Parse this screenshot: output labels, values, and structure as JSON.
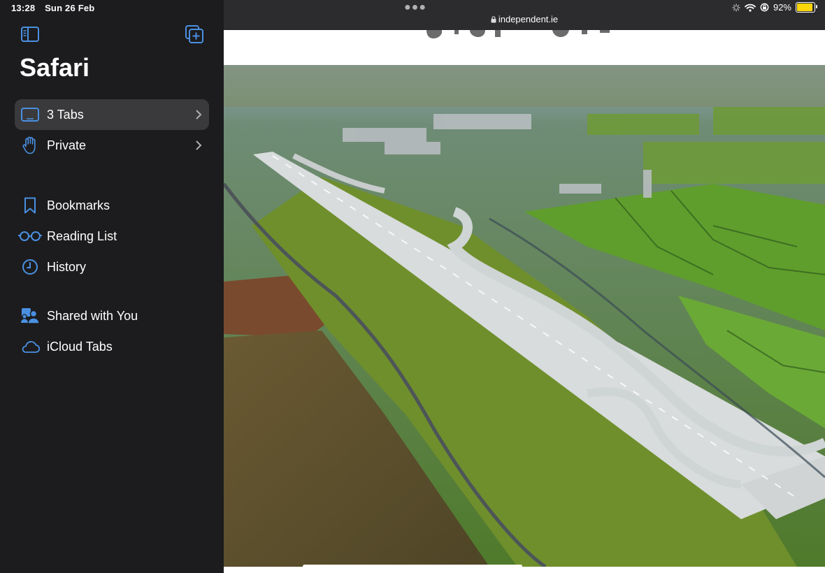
{
  "status": {
    "time": "13:28",
    "date": "Sun 26 Feb",
    "battery": "92%",
    "battery_level": 0.92
  },
  "sidebar": {
    "title": "Safari",
    "groups": [
      {
        "label": "3 Tabs",
        "icon": "tablet-icon",
        "selected": true,
        "chevron": true
      },
      {
        "label": "Private",
        "icon": "hand-icon",
        "chevron": true
      }
    ],
    "items": [
      {
        "label": "Bookmarks",
        "icon": "bookmark-icon"
      },
      {
        "label": "Reading List",
        "icon": "glasses-icon"
      },
      {
        "label": "History",
        "icon": "clock-icon"
      },
      {
        "label": "Shared with You",
        "icon": "people-icon"
      },
      {
        "label": "iCloud Tabs",
        "icon": "cloud-icon"
      }
    ]
  },
  "browser": {
    "url": "independent.ie",
    "page": {
      "image": "aerial-airport-runway-photo"
    }
  },
  "colors": {
    "accent": "#4a90e2",
    "sidebar_bg": "#1c1c1e",
    "selected_bg": "#3a3a3c",
    "battery": "#ffd60a"
  }
}
